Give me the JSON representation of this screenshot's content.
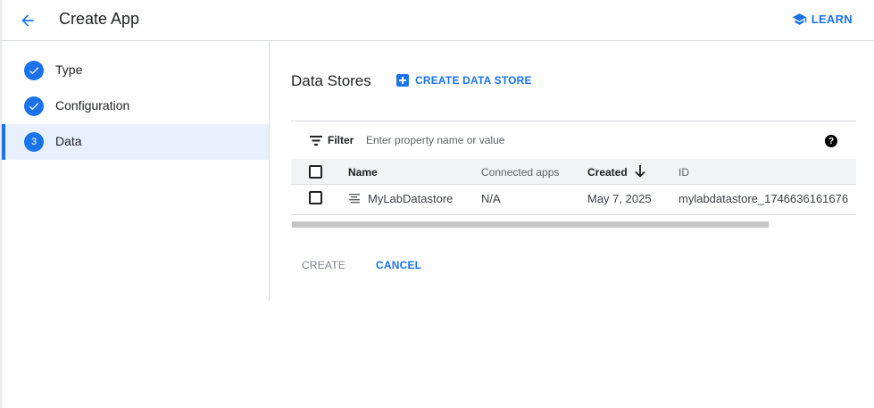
{
  "header": {
    "title": "Create App",
    "learn_label": "LEARN"
  },
  "steps": [
    {
      "label": "Type",
      "state": "done"
    },
    {
      "label": "Configuration",
      "state": "done"
    },
    {
      "label": "Data",
      "state": "active",
      "number": "3"
    }
  ],
  "main": {
    "title": "Data Stores",
    "create_data_store_label": "CREATE DATA STORE"
  },
  "filter": {
    "label": "Filter",
    "placeholder": "Enter property name or value"
  },
  "table": {
    "columns": {
      "name": "Name",
      "connected_apps": "Connected apps",
      "created": "Created",
      "id": "ID"
    },
    "sort": {
      "column": "Created",
      "direction": "descending"
    },
    "rows": [
      {
        "name": "MyLabDatastore",
        "connected_apps": "N/A",
        "created": "May 7, 2025",
        "id": "mylabdatastore_1746636161676"
      }
    ]
  },
  "actions": {
    "create_label": "CREATE",
    "cancel_label": "CANCEL"
  },
  "colors": {
    "accent": "#1a73e8",
    "active_step_bg": "#e8f0fe",
    "header_row_bg": "#f1f3f4"
  }
}
